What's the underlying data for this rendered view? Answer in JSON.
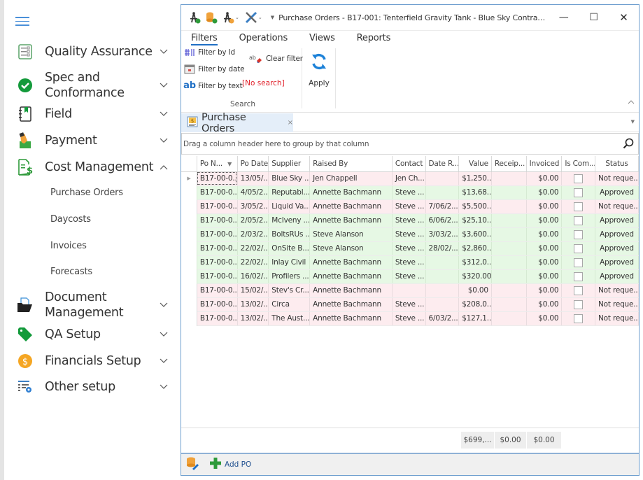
{
  "sidebar": {
    "menu_icon": "hamburger-icon",
    "items": [
      {
        "label": "Quality Assurance",
        "icon": "checklist-icon",
        "expanded": false
      },
      {
        "label": "Spec and Conformance",
        "icon": "check-circle-icon",
        "expanded": false
      },
      {
        "label": "Field",
        "icon": "notebook-icon",
        "expanded": false
      },
      {
        "label": "Payment",
        "icon": "hand-money-icon",
        "expanded": false
      },
      {
        "label": "Cost Management",
        "icon": "cost-document-icon",
        "expanded": true
      },
      {
        "label": "Document Management",
        "icon": "folder-open-icon",
        "expanded": false
      },
      {
        "label": "QA Setup",
        "icon": "tag-icon",
        "expanded": false
      },
      {
        "label": "Financials Setup",
        "icon": "dollar-coin-icon",
        "expanded": false
      },
      {
        "label": "Other setup",
        "icon": "settings-list-icon",
        "expanded": false
      }
    ],
    "cost_management_children": [
      "Purchase Orders",
      "Daycosts",
      "Invoices",
      "Forecasts"
    ],
    "chevron_down": "﹀",
    "chevron_up": "︿"
  },
  "window": {
    "title": "Purchase Orders - B17-001: Tenterfield Gravity Tank - Blue Sky Contracting ...",
    "minimize": "—",
    "maximize": "☐",
    "close": "✕"
  },
  "ribbon": {
    "tabs": [
      "Filters",
      "Operations",
      "Views",
      "Reports"
    ],
    "active_tab": "Filters",
    "filter_by_id": "Filter by Id",
    "filter_by_date": "Filter by date",
    "filter_by_text": "Filter by text",
    "clear_filter": "Clear filter",
    "no_search": "[No search]",
    "search_group": "Search",
    "apply": "Apply",
    "text_icon_glyph": "ab",
    "clear_icon_glyph": "ab"
  },
  "document_tab": {
    "label": "Purchase Orders",
    "close": "×"
  },
  "grid": {
    "group_hint": "Drag a column header here to group by that column",
    "columns": [
      "Po N...",
      "Po Date",
      "Supplier",
      "Raised By",
      "Contact",
      "Date R...",
      "Value",
      "Receip...",
      "Invoiced",
      "Is Com...",
      "Status"
    ],
    "sorted_column": "Po N...",
    "rows": [
      {
        "status_color": "pink",
        "po": "B17-00-0...",
        "date": "13/05/...",
        "supplier": "Blue Sky ...",
        "raised_by": "Jen Chappell",
        "contact": "Jen Ch...",
        "date_r": "",
        "value": "$1,250...",
        "receipt": "",
        "invoiced": "$0.00",
        "is_complete": false,
        "status": "Not reque..."
      },
      {
        "status_color": "green",
        "po": "B17-00-0...",
        "date": "4/05/2...",
        "supplier": "Reputabl...",
        "raised_by": "Annette Bachmann",
        "contact": "Steve ...",
        "date_r": "",
        "value": "$13,68...",
        "receipt": "",
        "invoiced": "$0.00",
        "is_complete": false,
        "status": "Approved"
      },
      {
        "status_color": "pink",
        "po": "B17-00-0...",
        "date": "3/05/2...",
        "supplier": "Liquid Va...",
        "raised_by": "Annette Bachmann",
        "contact": "Steve ...",
        "date_r": "7/06/2...",
        "value": "$5,500...",
        "receipt": "",
        "invoiced": "$0.00",
        "is_complete": false,
        "status": "Not reque..."
      },
      {
        "status_color": "green",
        "po": "B17-00-0...",
        "date": "2/05/2...",
        "supplier": "McIveny ...",
        "raised_by": "Annette Bachmann",
        "contact": "Steve ...",
        "date_r": "6/06/2...",
        "value": "$25,10...",
        "receipt": "",
        "invoiced": "$0.00",
        "is_complete": false,
        "status": "Approved"
      },
      {
        "status_color": "green",
        "po": "B17-00-0...",
        "date": "2/03/2...",
        "supplier": "BoltsRUs ...",
        "raised_by": "Steve Alanson",
        "contact": "Steve ...",
        "date_r": "3/03/2...",
        "value": "$3,600...",
        "receipt": "",
        "invoiced": "$0.00",
        "is_complete": false,
        "status": "Approved"
      },
      {
        "status_color": "green",
        "po": "B17-00-0...",
        "date": "22/02/...",
        "supplier": "OnSite B...",
        "raised_by": "Steve Alanson",
        "contact": "Steve ...",
        "date_r": "28/02/...",
        "value": "$2,860...",
        "receipt": "",
        "invoiced": "$0.00",
        "is_complete": false,
        "status": "Approved"
      },
      {
        "status_color": "green",
        "po": "B17-00-0...",
        "date": "22/02/...",
        "supplier": "Inlay Civil",
        "raised_by": "Annette Bachmann",
        "contact": "Steve ...",
        "date_r": "",
        "value": "$312,0...",
        "receipt": "",
        "invoiced": "$0.00",
        "is_complete": false,
        "status": "Approved"
      },
      {
        "status_color": "green",
        "po": "B17-00-0...",
        "date": "16/02/...",
        "supplier": "Profilers ...",
        "raised_by": "Annette Bachmann",
        "contact": "Steve ...",
        "date_r": "",
        "value": "$320.00",
        "receipt": "",
        "invoiced": "$0.00",
        "is_complete": false,
        "status": "Approved"
      },
      {
        "status_color": "pink",
        "po": "B17-00-0...",
        "date": "15/02/...",
        "supplier": "Stev's Cr...",
        "raised_by": "Annette Bachmann",
        "contact": "",
        "date_r": "",
        "value": "$0.00",
        "receipt": "",
        "invoiced": "$0.00",
        "is_complete": false,
        "status": "Not reque..."
      },
      {
        "status_color": "pink",
        "po": "B17-00-0...",
        "date": "13/02/...",
        "supplier": "Circa",
        "raised_by": "Annette Bachmann",
        "contact": "Steve ...",
        "date_r": "",
        "value": "$208,0...",
        "receipt": "",
        "invoiced": "$0.00",
        "is_complete": false,
        "status": "Not reque..."
      },
      {
        "status_color": "pink",
        "po": "B17-00-0...",
        "date": "13/02/...",
        "supplier": "The Aust...",
        "raised_by": "Annette Bachmann",
        "contact": "Steve ...",
        "date_r": "6/03/2...",
        "value": "$127,1...",
        "receipt": "",
        "invoiced": "$0.00",
        "is_complete": false,
        "status": "Not reque..."
      }
    ],
    "summary": {
      "value": "$699,...",
      "receipt": "$0.00",
      "invoiced": "$0.00"
    }
  },
  "bottom_bar": {
    "add_po": "Add PO"
  },
  "colors": {
    "accent": "#1f6fc5",
    "row_not_requested": "#fdecef",
    "row_approved": "#e6f8e4",
    "no_search_text": "#e0202a",
    "add_icon": "#2e9a3a"
  }
}
